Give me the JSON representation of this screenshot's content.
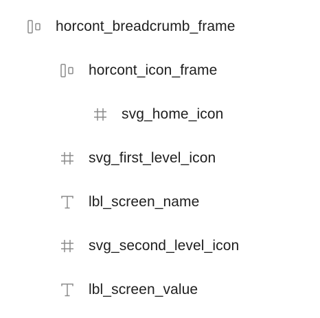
{
  "layers": [
    {
      "label": "horcont_breadcrumb_frame",
      "icon": "horizontal-auto-layout-icon"
    },
    {
      "label": "horcont_icon_frame",
      "icon": "horizontal-auto-layout-icon"
    },
    {
      "label": "svg_home_icon",
      "icon": "frame-hash-icon"
    },
    {
      "label": "svg_first_level_icon",
      "icon": "frame-hash-icon"
    },
    {
      "label": "lbl_screen_name",
      "icon": "text-icon"
    },
    {
      "label": "svg_second_level_icon",
      "icon": "frame-hash-icon"
    },
    {
      "label": "lbl_screen_value",
      "icon": "text-icon"
    }
  ],
  "colors": {
    "text": "#1e1e1e",
    "icon": "#8a8a8a",
    "background": "#ffffff"
  }
}
